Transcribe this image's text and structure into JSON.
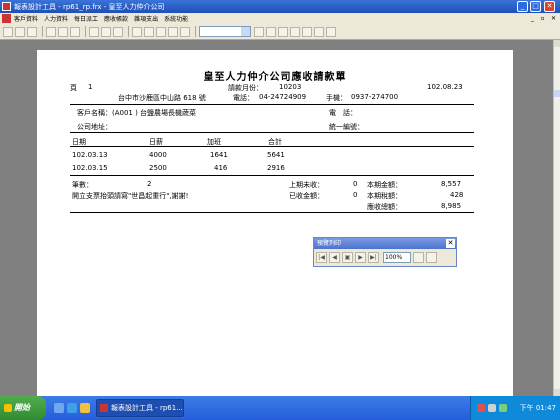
{
  "window": {
    "title": "報表設計工具 - rp61_rp.frx - 皇至人力仲介公司",
    "min": "_",
    "max": "□",
    "close": "✕"
  },
  "menu": {
    "items": [
      "客戶資料",
      "人力資料",
      "每日派工",
      "應收帳款",
      "雜項支出",
      "系統功能"
    ],
    "min": "_",
    "restore": "▫",
    "close": "✕"
  },
  "report": {
    "title": "皇至人力仲介公司應收請款單",
    "page_label": "頁",
    "page_no": "1",
    "period_label": "請款月份：",
    "period": "10203",
    "date": "102.08.23",
    "address": "台中市沙鹿區中山路 618 號",
    "phone_label": "電話：",
    "phone": "04-24724909",
    "mobile_label": "手機：",
    "mobile": "0937-274700",
    "customer_label": "客戶名稱：",
    "customer": "(A001 )  台鹽農場長機蔬菜",
    "tel_label": "電　話：",
    "company_addr_label": "公司地址：",
    "tax_id_label": "統一編號：",
    "columns": [
      "日期",
      "日薪",
      "加班",
      "合計"
    ],
    "rows": [
      [
        "102.03.13",
        "4000",
        "1641",
        "5641"
      ],
      [
        "102.03.15",
        "2500",
        "416",
        "2916"
      ]
    ],
    "count_label": "筆數：",
    "count": "2",
    "prev_unpaid_label": "上期未收：",
    "prev_unpaid": "0",
    "curr_amount_label": "本期金額：",
    "curr_amount": "8,557",
    "note": "開立支票抬頭請寫\"世昌起重行\",謝謝!",
    "received_label": "已收金額：",
    "received": "0",
    "curr_tax_label": "本期稅額：",
    "curr_tax": "428",
    "total_label": "應收總額：",
    "total": "8,985"
  },
  "preview": {
    "title": "預覽列印",
    "close": "✕",
    "zoom": "100%",
    "nav": [
      "|◀",
      "◀",
      "▣",
      "▶",
      "▶|"
    ]
  },
  "taskbar": {
    "start": "開始",
    "task": "報表設計工具 - rp61...",
    "clock": "下午 01:47"
  }
}
